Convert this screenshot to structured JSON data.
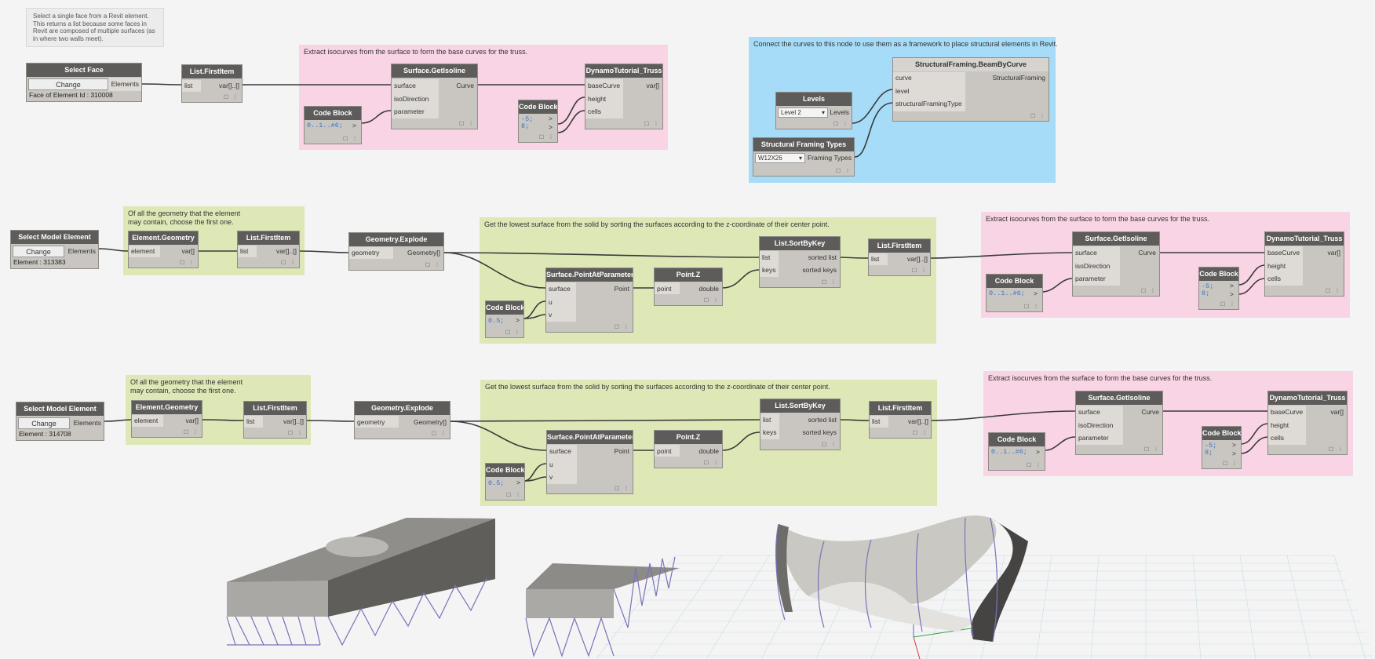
{
  "note": "Select a single face from a Revit element.  This returns a list because some faces in Revit are composed of multiple surfaces (as in where two walls meet).",
  "groups": {
    "g1_pink": "Extract isocurves from the surface to form the base curves for the truss.",
    "g1_blue": "Connect the curves to this node to use them as a framework to place structural elements in Revit.",
    "g2_first": "Of all the geometry that the element\nmay contain, choose the first one.",
    "g2_sort": "Get the lowest surface from the solid by sorting the surfaces according to the z-coordinate of their center point.",
    "g2_pink": "Extract isocurves from the surface to form the base curves for the truss.",
    "g3_first": "Of all the geometry that the element\nmay contain, choose the first one.",
    "g3_sort": "Get the lowest surface from the solid by sorting the surfaces according to the z-coordinate of their center point.",
    "g3_pink": "Extract isocurves from the surface to form the base curves for the truss."
  },
  "nodes": {
    "select_face": {
      "title": "Select Face",
      "button": "Change",
      "out": "Elements",
      "info": "Face of Element Id : 310008"
    },
    "first_a": {
      "title": "List.FirstItem",
      "in": "list",
      "out": "var[]..[]"
    },
    "isoline": {
      "title": "Surface.GetIsoline",
      "in": [
        "surface",
        "isoDirection",
        "parameter"
      ],
      "out": "Curve"
    },
    "code_range": {
      "title": "Code Block",
      "code": "0..1..#6;",
      "out": ">"
    },
    "code_two": {
      "title": "Code Block",
      "code": "-5;\n8;",
      "out": [
        ">",
        ">"
      ]
    },
    "truss": {
      "title": "DynamoTutorial_Truss",
      "in": [
        "baseCurve",
        "height",
        "cells"
      ],
      "out": "var[]"
    },
    "beam": {
      "title": "StructuralFraming.BeamByCurve",
      "in": [
        "curve",
        "level",
        "structuralFramingType"
      ],
      "out": "StructuralFraming"
    },
    "levels": {
      "title": "Levels",
      "value": "Level 2",
      "out": "Levels"
    },
    "types": {
      "title": "Structural Framing Types",
      "value": "W12X26",
      "out": "Framing Types"
    },
    "select_model_a": {
      "title": "Select Model Element",
      "button": "Change",
      "out": "Elements",
      "info": "Element : 313383"
    },
    "select_model_b": {
      "title": "Select Model Element",
      "button": "Change",
      "out": "Elements",
      "info": "Element : 314708"
    },
    "geometry": {
      "title": "Element.Geometry",
      "in": "element",
      "out": "var[]"
    },
    "first": {
      "title": "List.FirstItem",
      "in": "list",
      "out": "var[]..[]"
    },
    "explode": {
      "title": "Geometry.Explode",
      "in": "geometry",
      "out": "Geometry[]"
    },
    "point_at": {
      "title": "Surface.PointAtParameter",
      "in": [
        "surface",
        "u",
        "v"
      ],
      "out": "Point"
    },
    "point_z": {
      "title": "Point.Z",
      "in": "point",
      "out": "double"
    },
    "code_half": {
      "title": "Code Block",
      "code": "0.5;",
      "out": ">"
    },
    "sort": {
      "title": "List.SortByKey",
      "in": [
        "list",
        "keys"
      ],
      "out": [
        "sorted list",
        "sorted keys"
      ]
    }
  },
  "colors": {
    "pink": "#f9d4e4",
    "blue": "#a6dcf7",
    "green": "#dde8b6",
    "node_header": "#5d5c5a",
    "node_body": "#c9c6c1",
    "wire": "#3a3a3a",
    "truss": "#7a72b8"
  }
}
